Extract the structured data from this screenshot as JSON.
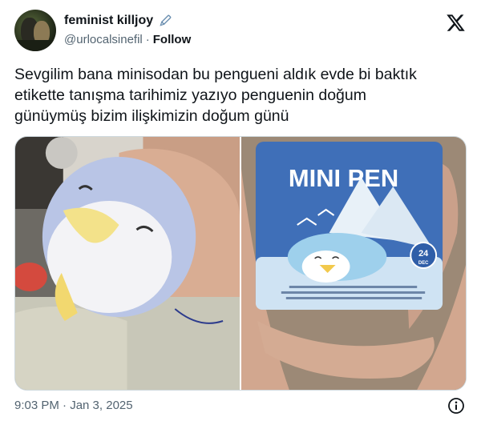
{
  "author": {
    "display_name": "feminist killjoy",
    "handle": "@urlocalsinefil",
    "separator": "·",
    "follow_label": "Follow"
  },
  "icons": {
    "verified_badge": "pencil-icon",
    "platform_logo": "x-logo-icon",
    "info": "info-icon"
  },
  "tweet": {
    "text": "Sevgilim bana minisodan bu pengueni aldık evde bi baktık\netikette tanışma tarihimiz yazıyo penguenin doğum\ngünüymüş bizim ilişkimizin doğum günü",
    "timestamp": "9:03 PM · Jan 3, 2025"
  },
  "media": {
    "card_title": "MINI PEN",
    "card_date_number": "24",
    "card_date_month": "DEC"
  },
  "colors": {
    "text_primary": "#0f1419",
    "text_secondary": "#536471",
    "card_blue": "#3f6fb8",
    "border": "#cfd9de"
  }
}
